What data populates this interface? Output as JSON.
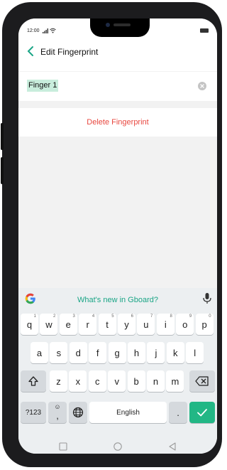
{
  "status": {
    "time": "12:00",
    "signal": "signal-icon",
    "wifi": "wifi-icon",
    "battery": "battery-icon"
  },
  "header": {
    "back_icon": "chevron-left-icon",
    "title": "Edit Fingerprint"
  },
  "name_field": {
    "value": "Finger 1",
    "clear_icon": "clear-circle-icon"
  },
  "actions": {
    "delete_label": "Delete Fingerprint"
  },
  "gboard": {
    "logo_icon": "google-g-icon",
    "suggestion": "What's new in Gboard?",
    "mic_icon": "mic-icon",
    "row1": [
      {
        "k": "q",
        "s": "1"
      },
      {
        "k": "w",
        "s": "2"
      },
      {
        "k": "e",
        "s": "3"
      },
      {
        "k": "r",
        "s": "4"
      },
      {
        "k": "t",
        "s": "5"
      },
      {
        "k": "y",
        "s": "6"
      },
      {
        "k": "u",
        "s": "7"
      },
      {
        "k": "i",
        "s": "8"
      },
      {
        "k": "o",
        "s": "9"
      },
      {
        "k": "p",
        "s": "0"
      }
    ],
    "row2": [
      "a",
      "s",
      "d",
      "f",
      "g",
      "h",
      "j",
      "k",
      "l"
    ],
    "row3": [
      "z",
      "x",
      "c",
      "v",
      "b",
      "n",
      "m"
    ],
    "shift_icon": "shift-icon",
    "backspace_icon": "backspace-icon",
    "symbols_label": "?123",
    "emoji_key": {
      "top": "☺",
      "bottom": ","
    },
    "globe_icon": "globe-icon",
    "space_label": "English",
    "period_label": ".",
    "enter_icon": "checkmark-icon",
    "accent": "#22b785"
  },
  "nav": {
    "recents_icon": "square-icon",
    "home_icon": "circle-icon",
    "back_icon": "triangle-back-icon"
  },
  "colors": {
    "delete_text": "#e8473f",
    "highlight": "#c8eddc",
    "link": "#1aa586"
  }
}
